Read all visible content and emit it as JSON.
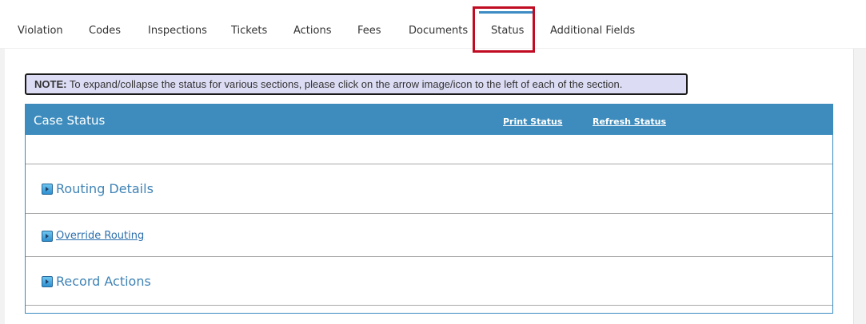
{
  "tabs": [
    {
      "label": "Violation"
    },
    {
      "label": "Codes"
    },
    {
      "label": "Inspections"
    },
    {
      "label": "Tickets"
    },
    {
      "label": "Actions"
    },
    {
      "label": "Fees"
    },
    {
      "label": "Documents"
    },
    {
      "label": "Status",
      "active": true
    },
    {
      "label": "Additional Fields"
    }
  ],
  "note": {
    "prefix": "NOTE:",
    "text": " To expand/collapse the status for various sections, please click on the arrow image/icon to the left of each of the section."
  },
  "panel": {
    "title": "Case Status",
    "print_link": "Print Status",
    "refresh_link": "Refresh Status",
    "sections": [
      {
        "label": "Routing Details",
        "icon": "expand-arrow-icon"
      },
      {
        "label": "Override Routing",
        "icon": "expand-arrow-icon"
      },
      {
        "label": "Record Actions",
        "icon": "expand-arrow-icon"
      }
    ]
  },
  "colors": {
    "accent": "#3d8cbd",
    "active_tab_highlight": "#c00b22",
    "note_background": "#dcdcf5",
    "section_text": "#3f83b5"
  }
}
